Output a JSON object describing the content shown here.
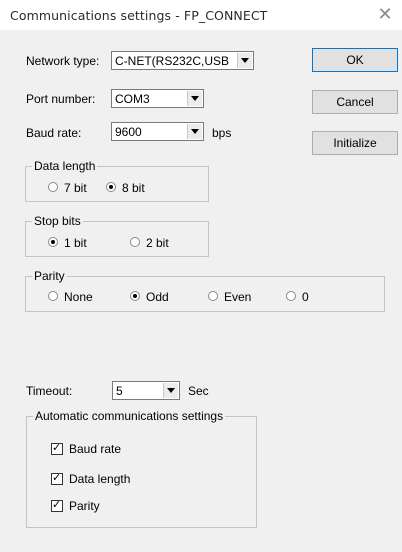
{
  "window": {
    "title": "Communications settings - FP_CONNECT",
    "close_glyph": "✕"
  },
  "fields": {
    "network_type": {
      "label": "Network type:",
      "value": "C-NET(RS232C,USB"
    },
    "port_number": {
      "label": "Port number:",
      "value": "COM3"
    },
    "baud_rate": {
      "label": "Baud rate:",
      "value": "9600",
      "unit": "bps"
    },
    "timeout": {
      "label": "Timeout:",
      "value": "5",
      "unit": "Sec"
    }
  },
  "buttons": {
    "ok": "OK",
    "cancel": "Cancel",
    "initialize": "Initialize"
  },
  "data_length": {
    "legend": "Data length",
    "options": [
      "7 bit",
      "8 bit"
    ],
    "selected": "8 bit"
  },
  "stop_bits": {
    "legend": "Stop bits",
    "options": [
      "1 bit",
      "2 bit"
    ],
    "selected": "1 bit"
  },
  "parity": {
    "legend": "Parity",
    "options": [
      "None",
      "Odd",
      "Even",
      "0"
    ],
    "selected": "Odd"
  },
  "auto": {
    "legend": "Automatic communications settings",
    "items": [
      {
        "label": "Baud rate",
        "checked": true
      },
      {
        "label": "Data length",
        "checked": true
      },
      {
        "label": "Parity",
        "checked": true
      }
    ]
  }
}
